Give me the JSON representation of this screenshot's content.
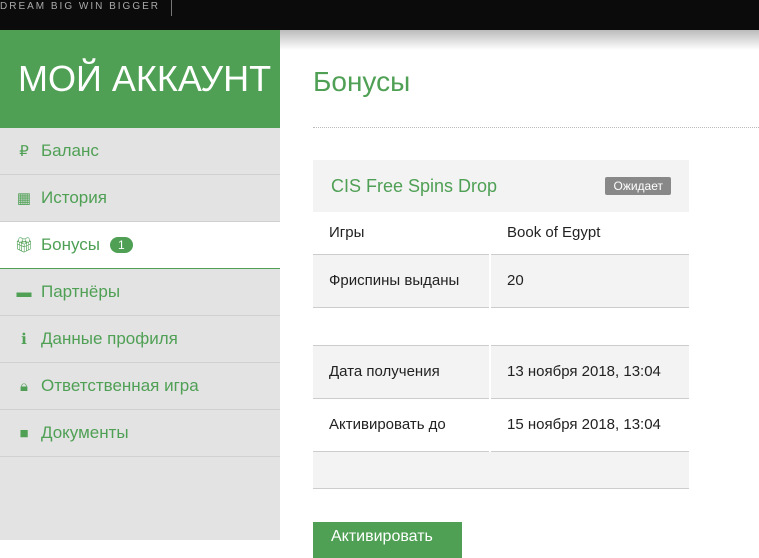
{
  "header": {
    "tagline": "DREAM BIG  WIN BIGGER"
  },
  "sidebar": {
    "title": "МОЙ АККАУНТ",
    "items": [
      {
        "label": "Баланс",
        "icon": "ruble-icon"
      },
      {
        "label": "История",
        "icon": "calendar-icon"
      },
      {
        "label": "Бонусы",
        "icon": "gift-icon",
        "badge": "1"
      },
      {
        "label": "Партнёры",
        "icon": "briefcase-icon"
      },
      {
        "label": "Данные профиля",
        "icon": "info-icon"
      },
      {
        "label": "Ответственная игра",
        "icon": "lock-icon"
      },
      {
        "label": "Документы",
        "icon": "folder-icon"
      }
    ]
  },
  "main": {
    "title": "Бонусы",
    "bonus": {
      "name": "CIS Free Spins Drop",
      "status": "Ожидает",
      "rows": [
        {
          "label": "Игры",
          "value": "Book of Egypt"
        },
        {
          "label": "Фриспины выданы",
          "value": "20"
        },
        {
          "label": "Дата получения",
          "value": "13 ноября 2018, 13:04"
        },
        {
          "label": "Активировать до",
          "value": "15 ноября 2018, 13:04"
        }
      ]
    },
    "activate": "Активировать"
  }
}
